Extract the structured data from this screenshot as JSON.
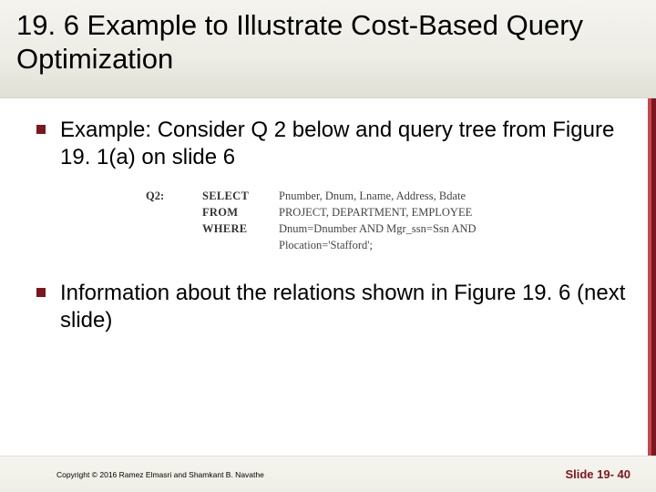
{
  "title": "19. 6 Example to Illustrate Cost-Based Query Optimization",
  "bullets": {
    "b1": "Example: Consider Q 2 below and query tree from Figure 19. 1(a) on slide 6",
    "b2": "Information about the relations shown in Figure 19. 6 (next slide)"
  },
  "sql": {
    "label": "Q2:",
    "select_kw": "SELECT",
    "select_val": "Pnumber, Dnum, Lname, Address, Bdate",
    "from_kw": "FROM",
    "from_val": "PROJECT, DEPARTMENT, EMPLOYEE",
    "where_kw": "WHERE",
    "where_val1": "Dnum=Dnumber AND Mgr_ssn=Ssn AND",
    "where_val2": "Plocation='Stafford';"
  },
  "footer": {
    "copyright": "Copyright © 2016 Ramez Elmasri and Shamkant B. Navathe",
    "slide_num": "Slide 19- 40"
  }
}
